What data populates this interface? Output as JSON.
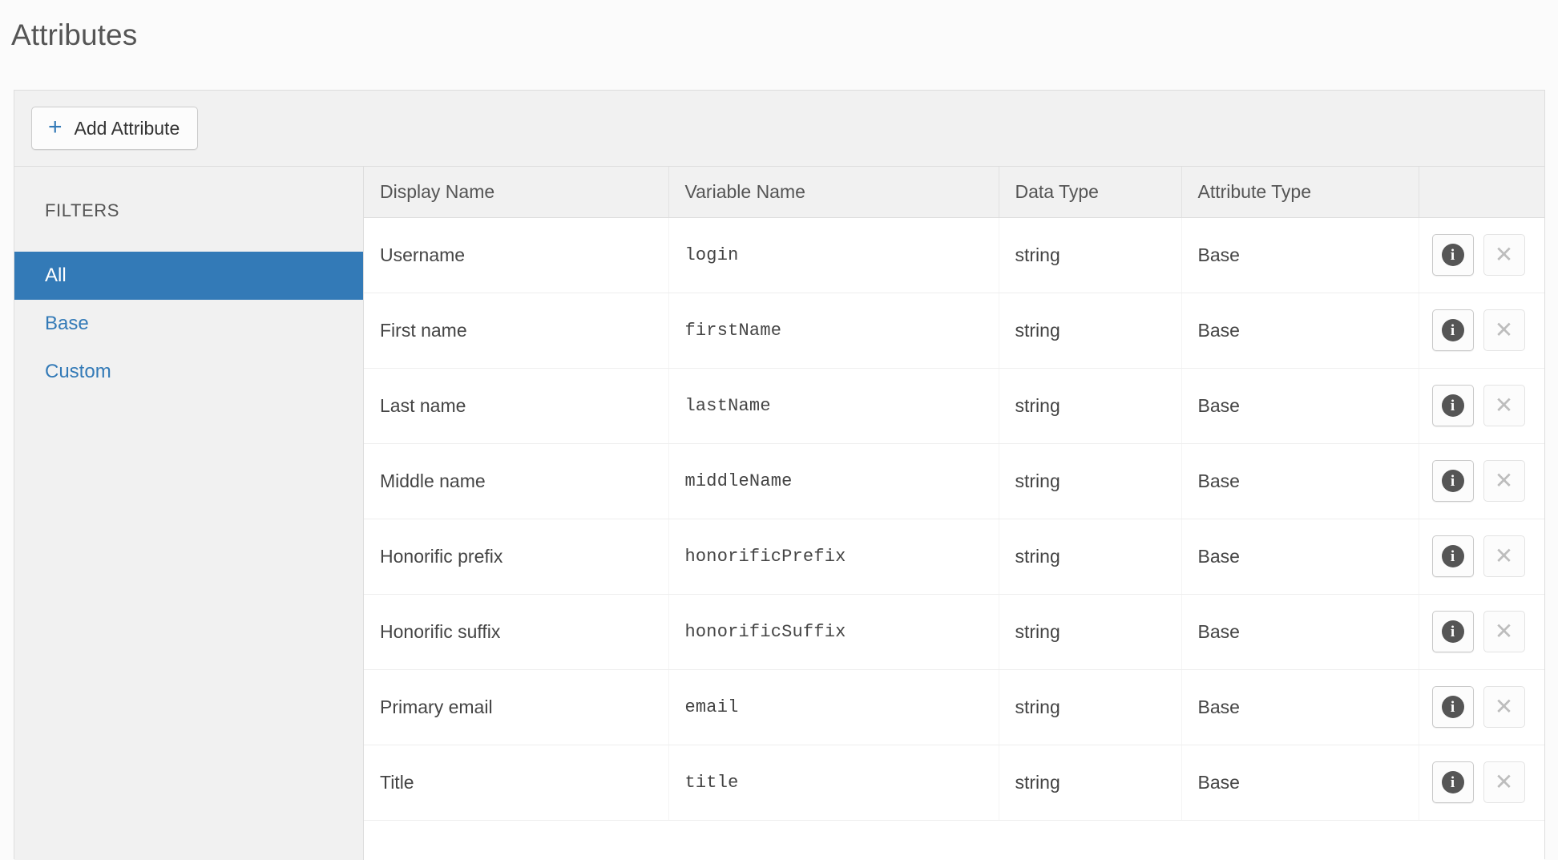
{
  "page": {
    "title": "Attributes"
  },
  "toolbar": {
    "add_label": "Add Attribute",
    "plus_glyph": "+",
    "plus_color": "#337ab7"
  },
  "sidebar": {
    "heading": "FILTERS",
    "items": [
      {
        "label": "All",
        "active": true
      },
      {
        "label": "Base",
        "active": false
      },
      {
        "label": "Custom",
        "active": false
      }
    ],
    "active_bg": "#337ab7",
    "link_color": "#337ab7"
  },
  "table": {
    "columns": [
      {
        "key": "display_name",
        "label": "Display Name"
      },
      {
        "key": "variable_name",
        "label": "Variable Name"
      },
      {
        "key": "data_type",
        "label": "Data Type"
      },
      {
        "key": "attribute_type",
        "label": "Attribute Type"
      },
      {
        "key": "actions",
        "label": ""
      }
    ],
    "row_actions": {
      "info_label": "i",
      "close_label": "✕"
    },
    "rows": [
      {
        "display_name": "Username",
        "variable_name": "login",
        "data_type": "string",
        "attribute_type": "Base"
      },
      {
        "display_name": "First name",
        "variable_name": "firstName",
        "data_type": "string",
        "attribute_type": "Base"
      },
      {
        "display_name": "Last name",
        "variable_name": "lastName",
        "data_type": "string",
        "attribute_type": "Base"
      },
      {
        "display_name": "Middle name",
        "variable_name": "middleName",
        "data_type": "string",
        "attribute_type": "Base"
      },
      {
        "display_name": "Honorific prefix",
        "variable_name": "honorificPrefix",
        "data_type": "string",
        "attribute_type": "Base"
      },
      {
        "display_name": "Honorific suffix",
        "variable_name": "honorificSuffix",
        "data_type": "string",
        "attribute_type": "Base"
      },
      {
        "display_name": "Primary email",
        "variable_name": "email",
        "data_type": "string",
        "attribute_type": "Base"
      },
      {
        "display_name": "Title",
        "variable_name": "title",
        "data_type": "string",
        "attribute_type": "Base"
      }
    ]
  }
}
